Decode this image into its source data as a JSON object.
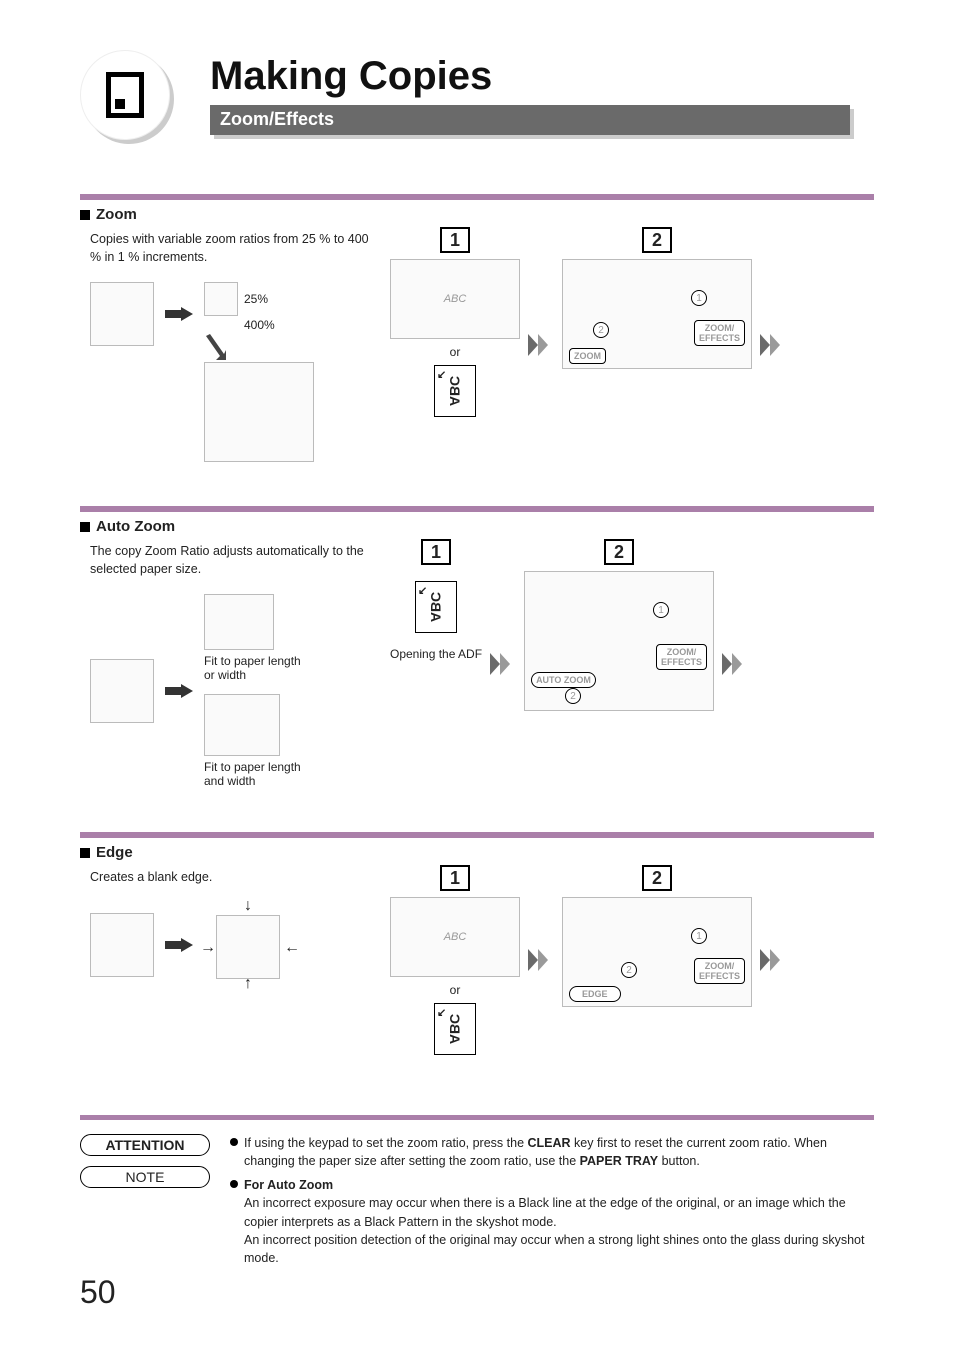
{
  "header": {
    "title": "Making Copies",
    "subtitle": "Zoom/Effects"
  },
  "sections": {
    "zoom": {
      "title": "Zoom",
      "desc": "Copies with variable zoom ratios from 25 % to 400 % in 1 % increments.",
      "pct_min": "25%",
      "pct_max": "400%",
      "step1": "1",
      "or": "or",
      "step2": "2",
      "screen_btn_effects": "ZOOM/\nEFFECTS",
      "screen_btn_zoom": "ZOOM"
    },
    "auto_zoom": {
      "title": "Auto Zoom",
      "desc": "The copy Zoom Ratio adjusts automatically to the selected paper size.",
      "cap1": "Fit to paper length or width",
      "cap2": "Fit to paper length and width",
      "step1": "1",
      "adf": "Opening the ADF",
      "step2": "2",
      "screen_btn_effects": "ZOOM/\nEFFECTS",
      "screen_btn_auto": "AUTO ZOOM"
    },
    "edge": {
      "title": "Edge",
      "desc": "Creates a blank edge.",
      "step1": "1",
      "or": "or",
      "step2": "2",
      "screen_btn_effects": "ZOOM/\nEFFECTS",
      "screen_btn_edge": "EDGE"
    }
  },
  "notes": {
    "attention_label": "ATTENTION",
    "note_label": "NOTE",
    "attention_pre": "If using the keypad to set the zoom ratio, press the ",
    "attention_clear": "CLEAR",
    "attention_mid": " key first to reset the current zoom ratio. When changing the paper size after setting the zoom ratio, use the ",
    "attention_paper": "PAPER TRAY",
    "attention_post": " button.",
    "note_title": "For Auto Zoom",
    "note_line1": "An incorrect exposure may occur when there is a Black line at the edge of the original, or an image which the copier interprets as a Black Pattern in the skyshot mode.",
    "note_line2": "An incorrect position detection of the original may occur when a strong light shines onto the glass during skyshot mode."
  },
  "page_number": "50",
  "abc_text": "ABC",
  "callouts": {
    "c1": "1",
    "c2": "2"
  }
}
